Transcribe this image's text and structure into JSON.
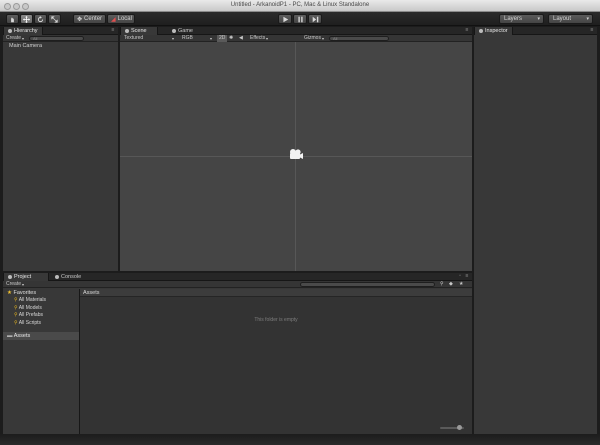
{
  "window": {
    "title": "Untitled - ArkanoidP1 - PC, Mac & Linux Standalone"
  },
  "toolbar": {
    "pivot_label": "Center",
    "space_label": "Local",
    "layers_label": "Layers",
    "layout_label": "Layout"
  },
  "hierarchy": {
    "tab_label": "Hierarchy",
    "create_label": "Create",
    "search_placeholder": "All",
    "items": [
      "Main Camera"
    ]
  },
  "scene": {
    "tab_scene": "Scene",
    "tab_game": "Game",
    "draw_mode": "Textured",
    "render_mode": "RGB",
    "mode_2d": "2D",
    "effects_label": "Effects",
    "gizmos_label": "Gizmos",
    "search_placeholder": "All"
  },
  "inspector": {
    "tab_label": "Inspector"
  },
  "project": {
    "tab_project": "Project",
    "tab_console": "Console",
    "create_label": "Create",
    "favorites_label": "Favorites",
    "favorites": [
      "All Materials",
      "All Models",
      "All Prefabs",
      "All Scripts"
    ],
    "assets_label": "Assets",
    "breadcrumb": "Assets",
    "empty_message": "This folder is empty"
  }
}
